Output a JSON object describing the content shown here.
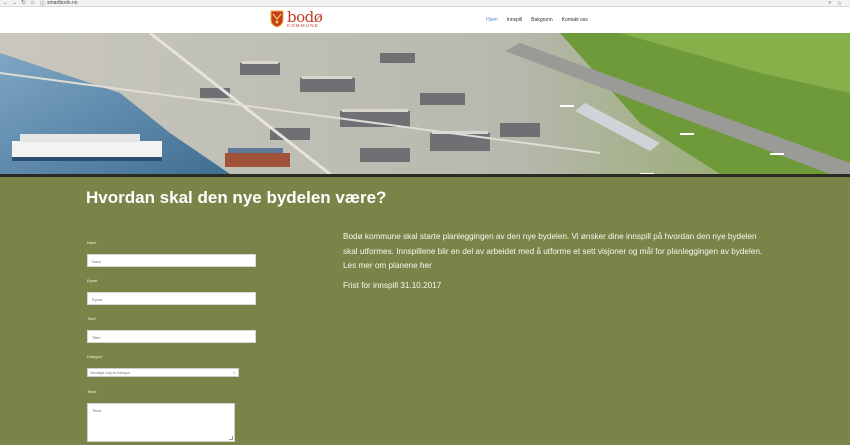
{
  "browser": {
    "url": "smartbodo.no",
    "icons": [
      "back-icon",
      "forward-icon",
      "reload-icon",
      "home-icon",
      "info-icon",
      "search-icon",
      "star-icon"
    ]
  },
  "logo": {
    "brand": "bodø",
    "sub": "KOMMUNE",
    "shield_color": "#c23b22"
  },
  "menu": {
    "items": [
      {
        "label": "Hjem",
        "active": true
      },
      {
        "label": "Innspill",
        "active": false
      },
      {
        "label": "Bakgrunn",
        "active": false
      },
      {
        "label": "Kontakt oss",
        "active": false
      }
    ]
  },
  "colors": {
    "page_bg": "#7a8449",
    "active_menu": "#5a8fc8",
    "text": "#f6f7ee"
  },
  "content": {
    "headline": "Hvordan skal den nye bydelen være?",
    "intro_text": "Bodø kommune skal starte planleggingen av den nye bydelen. Vi ønsker dine innspill på hvordan den nye bydelen skal utformes. Innspillene blir en del av arbeidet med å utforme et sett visjoner og mål for planleggingen av bydelen. Les mer om planene ",
    "intro_link": "her",
    "deadline": "Frist for innspill 31.10.2017"
  },
  "form": {
    "name_label": "Navn",
    "name_placeholder": "Navn",
    "email_label": "Epost",
    "email_placeholder": "Epost",
    "title_label": "Tittel",
    "title_placeholder": "Tittel",
    "category_label": "Kategori",
    "category_value": "Vennligst velg en kategori",
    "text_label": "Tekst",
    "text_placeholder": "Tekst"
  }
}
